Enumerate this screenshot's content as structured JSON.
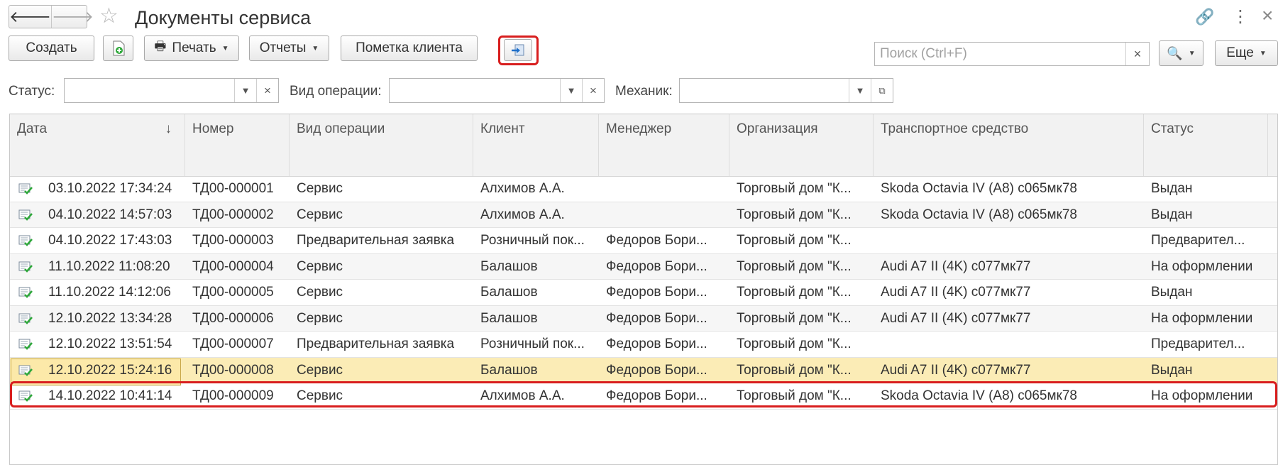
{
  "window": {
    "title": "Документы сервиса",
    "nav_back": "🡐",
    "nav_forward": "🡒"
  },
  "toolbar": {
    "create": "Создать",
    "print": "Печать",
    "reports": "Отчеты",
    "client_mark": "Пометка клиента",
    "more": "Еще"
  },
  "search": {
    "placeholder": "Поиск (Ctrl+F)"
  },
  "filters": {
    "status_label": "Статус:",
    "operation_label": "Вид операции:",
    "mechanic_label": "Механик:"
  },
  "table": {
    "columns": [
      "Дата",
      "Номер",
      "Вид операции",
      "Клиент",
      "Менеджер",
      "Организация",
      "Транспортное средство",
      "Статус"
    ],
    "rows": [
      {
        "date": "03.10.2022 17:34:24",
        "num": "ТД00-000001",
        "op": "Сервис",
        "client": "Алхимов А.А.",
        "manager": "",
        "org": "Торговый дом \"К...",
        "vehicle": "Skoda Octavia IV (A8) с065мк78",
        "status": "Выдан"
      },
      {
        "date": "04.10.2022 14:57:03",
        "num": "ТД00-000002",
        "op": "Сервис",
        "client": "Алхимов А.А.",
        "manager": "",
        "org": "Торговый дом \"К...",
        "vehicle": "Skoda Octavia IV (A8) с065мк78",
        "status": "Выдан"
      },
      {
        "date": "04.10.2022 17:43:03",
        "num": "ТД00-000003",
        "op": "Предварительная заявка",
        "client": "Розничный пок...",
        "manager": "Федоров Бори...",
        "org": "Торговый дом \"К...",
        "vehicle": "",
        "status": "Предварител..."
      },
      {
        "date": "11.10.2022 11:08:20",
        "num": "ТД00-000004",
        "op": "Сервис",
        "client": "Балашов",
        "manager": "Федоров Бори...",
        "org": "Торговый дом \"К...",
        "vehicle": "Audi A7 II (4K) с077мк77",
        "status": "На оформлении"
      },
      {
        "date": "11.10.2022 14:12:06",
        "num": "ТД00-000005",
        "op": "Сервис",
        "client": "Балашов",
        "manager": "Федоров Бори...",
        "org": "Торговый дом \"К...",
        "vehicle": "Audi A7 II (4K) с077мк77",
        "status": "Выдан"
      },
      {
        "date": "12.10.2022 13:34:28",
        "num": "ТД00-000006",
        "op": "Сервис",
        "client": "Балашов",
        "manager": "Федоров Бори...",
        "org": "Торговый дом \"К...",
        "vehicle": "Audi A7 II (4K) с077мк77",
        "status": "На оформлении"
      },
      {
        "date": "12.10.2022 13:51:54",
        "num": "ТД00-000007",
        "op": "Предварительная заявка",
        "client": "Розничный пок...",
        "manager": "Федоров Бори...",
        "org": "Торговый дом \"К...",
        "vehicle": "",
        "status": "Предварител..."
      },
      {
        "date": "12.10.2022 15:24:16",
        "num": "ТД00-000008",
        "op": "Сервис",
        "client": "Балашов",
        "manager": "Федоров Бори...",
        "org": "Торговый дом \"К...",
        "vehicle": "Audi A7 II (4K) с077мк77",
        "status": "Выдан"
      },
      {
        "date": "14.10.2022 10:41:14",
        "num": "ТД00-000009",
        "op": "Сервис",
        "client": "Алхимов А.А.",
        "manager": "Федоров Бори...",
        "org": "Торговый дом \"К...",
        "vehicle": "Skoda Octavia IV (A8) с065мк78",
        "status": "На оформлении"
      }
    ],
    "selected_row": 7
  },
  "colors": {
    "highlight": "#d81e1e",
    "selected_row": "#fbecb6",
    "accent_icon": "#1f6fc9"
  }
}
